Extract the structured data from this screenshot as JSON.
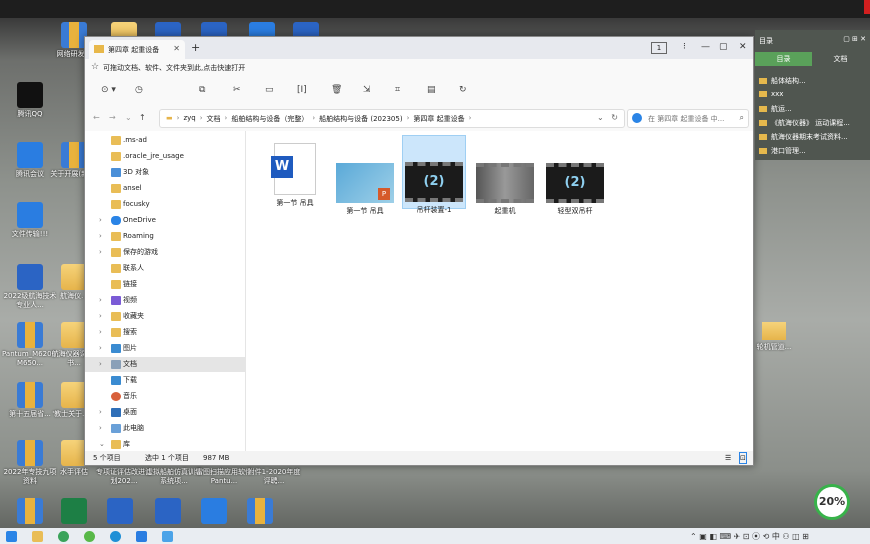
{
  "desktop": {
    "icons": [
      {
        "label": "网络研发..."
      },
      {
        "label": "腾讯QQ"
      },
      {
        "label": "腾讯会议"
      },
      {
        "label": "关于开展(新)..."
      },
      {
        "label": "文件传输!!!"
      },
      {
        "label": "2022级航海技术专业人..."
      },
      {
        "label": "航海仪..."
      },
      {
        "label": "Pantum_M6200-M650..."
      },
      {
        "label": "航海仪器课(通书..."
      },
      {
        "label": "第十五届省..."
      },
      {
        "label": "'教士关于...料"
      },
      {
        "label": "2022年专技九项资料"
      },
      {
        "label": "水手评估"
      },
      {
        "label": "专项证评估改进计划202..."
      },
      {
        "label": "虚拟船舶仿真训练系统项..."
      },
      {
        "label": "雷图扫描应用软件 Pantu..."
      },
      {
        "label": "附件1-2020年度评聘..."
      }
    ],
    "right_folder": "轮机管道..."
  },
  "explorer": {
    "tab_label": "第四章 起重设备",
    "page_badge": "1",
    "bookmark_text": "可拖动文档、软件、文件夹到此,点击快速打开",
    "breadcrumbs": [
      "zyq",
      "文档",
      "船舶结构与设备（完整）",
      "船舶结构与设备 (202305)",
      "第四章 起重设备"
    ],
    "search_placeholder": "在 第四章 起重设备 中...",
    "sidebar": [
      {
        "label": ".ms-ad",
        "chev": ""
      },
      {
        "label": ".oracle_jre_usage",
        "chev": ""
      },
      {
        "label": "3D 对象",
        "chev": ""
      },
      {
        "label": "ansel",
        "chev": ""
      },
      {
        "label": "focusky",
        "chev": ""
      },
      {
        "label": "OneDrive",
        "chev": "›"
      },
      {
        "label": "Roaming",
        "chev": "›"
      },
      {
        "label": "保存的游戏",
        "chev": "›"
      },
      {
        "label": "联系人",
        "chev": ""
      },
      {
        "label": "链接",
        "chev": ""
      },
      {
        "label": "视频",
        "chev": "›"
      },
      {
        "label": "收藏夹",
        "chev": "›"
      },
      {
        "label": "搜索",
        "chev": "›"
      },
      {
        "label": "图片",
        "chev": "›"
      },
      {
        "label": "文档",
        "chev": "›"
      },
      {
        "label": "下载",
        "chev": ""
      },
      {
        "label": "音乐",
        "chev": ""
      },
      {
        "label": "桌面",
        "chev": "›"
      },
      {
        "label": "此电脑",
        "chev": "›"
      },
      {
        "label": "库",
        "chev": "⌄"
      }
    ],
    "files": [
      {
        "name": "第一节 吊具",
        "kind": "word"
      },
      {
        "name": "第一节 吊具",
        "kind": "ppt"
      },
      {
        "name": "吊杆装置-1",
        "kind": "video"
      },
      {
        "name": "起重机",
        "kind": "video-gray"
      },
      {
        "name": "轻型双吊杆",
        "kind": "video"
      }
    ],
    "status": {
      "count": "5 个项目",
      "selected": "选中 1 个项目",
      "size": "987 MB"
    }
  },
  "right_panel": {
    "title": "目录",
    "tabs": [
      "目录",
      "文档"
    ],
    "items": [
      "船体结构...",
      "xxx",
      "航运...",
      "《航海仪器》 运动课程...",
      "航海仪器期末考试资料...",
      "港口管理..."
    ]
  },
  "progress_badge": "20%",
  "colors": {
    "accent": "#2a84e6",
    "selection": "#cce6fb",
    "panel_tab": "#5aa15a"
  }
}
